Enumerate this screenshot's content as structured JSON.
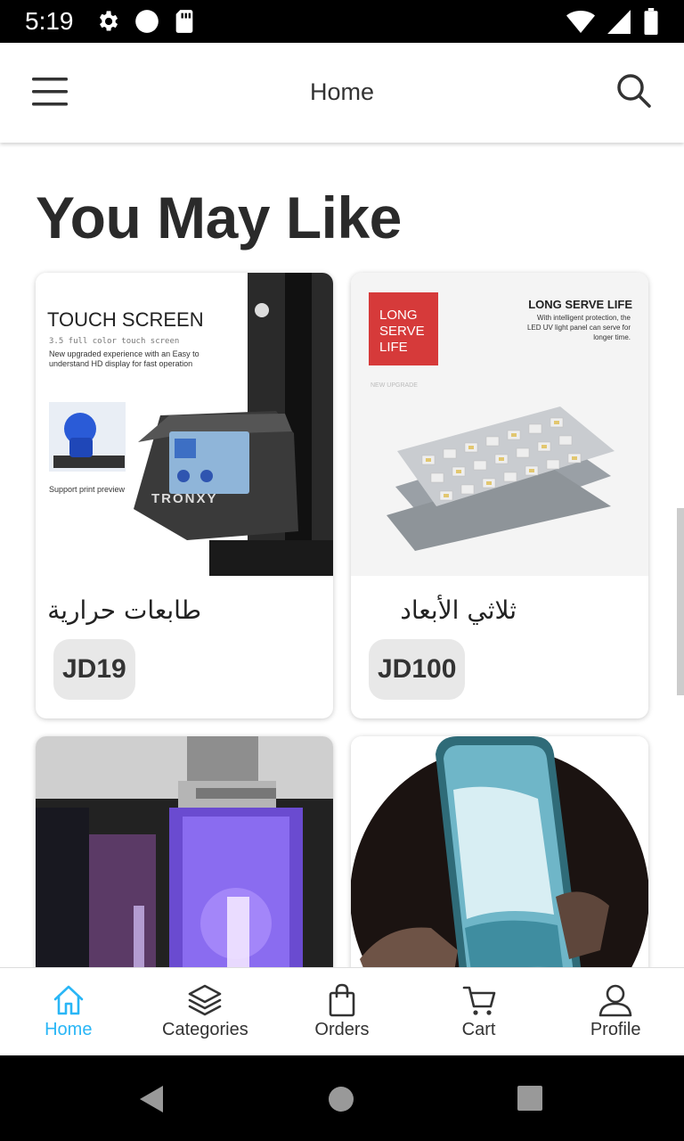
{
  "status_bar": {
    "time": "5:19"
  },
  "app_bar": {
    "title": "Home"
  },
  "section": {
    "title": "You May Like"
  },
  "products": [
    {
      "name": "طابعات حرارية",
      "price": "JD19",
      "image_text": {
        "headline": "TOUCH SCREEN",
        "subline": "3.5 full color touch screen",
        "desc1": "New upgraded experience with an Easy to",
        "desc2": "understand HD display for fast operation",
        "caption": "Support print preview",
        "brand": "TRONXY"
      }
    },
    {
      "name": "ثلاثي الأبعاد",
      "price": "JD100",
      "image_text": {
        "badge_line1": "LONG",
        "badge_line2": "SERVE",
        "badge_line3": "LIFE",
        "headline": "LONG SERVE LIFE",
        "desc1": "With intelligent protection, the",
        "desc2": "LED UV light panel can serve for",
        "desc3": "longer time.",
        "tag": "NEW UPGRADE"
      }
    },
    {
      "name": "",
      "price": ""
    },
    {
      "name": "",
      "price": ""
    }
  ],
  "bottom_nav": [
    {
      "label": "Home",
      "icon": "home-icon",
      "active": true
    },
    {
      "label": "Categories",
      "icon": "layers-icon",
      "active": false
    },
    {
      "label": "Orders",
      "icon": "shopping-bag-icon",
      "active": false
    },
    {
      "label": "Cart",
      "icon": "cart-icon",
      "active": false
    },
    {
      "label": "Profile",
      "icon": "person-icon",
      "active": false
    }
  ],
  "colors": {
    "accent": "#29b6f6",
    "text_primary": "#2a2a2a",
    "chip_bg": "#e8e8e8"
  }
}
